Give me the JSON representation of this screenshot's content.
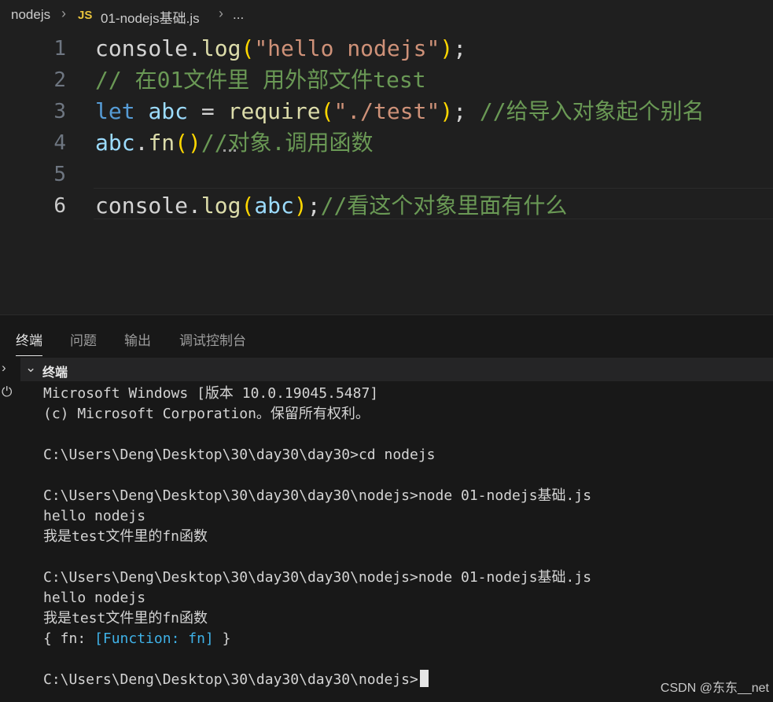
{
  "breadcrumb": {
    "folder": "nodejs",
    "file_badge": "JS",
    "file": "01-nodejs基础.js",
    "ellipsis": "..."
  },
  "editor": {
    "line_numbers": [
      "1",
      "2",
      "3",
      "4",
      "5",
      "6"
    ],
    "lines": [
      [
        {
          "t": "console",
          "c": "t-plain"
        },
        {
          "t": ".",
          "c": "t-plain"
        },
        {
          "t": "log",
          "c": "t-fn"
        },
        {
          "t": "(",
          "c": "t-paren"
        },
        {
          "t": "\"hello nodejs\"",
          "c": "t-str"
        },
        {
          "t": ")",
          "c": "t-paren"
        },
        {
          "t": ";",
          "c": "t-plain"
        }
      ],
      [
        {
          "t": "// 在01文件里 用外部文件test",
          "c": "t-com"
        }
      ],
      [
        {
          "t": "let",
          "c": "t-kw"
        },
        {
          "t": " ",
          "c": "t-plain"
        },
        {
          "t": "abc",
          "c": "t-var"
        },
        {
          "t": " = ",
          "c": "t-plain"
        },
        {
          "t": "require",
          "c": "t-fn"
        },
        {
          "t": "(",
          "c": "t-paren"
        },
        {
          "t": "\"./test\"",
          "c": "t-str"
        },
        {
          "t": ")",
          "c": "t-paren"
        },
        {
          "t": "; ",
          "c": "t-plain"
        },
        {
          "t": "//给导入对象起个别名",
          "c": "t-com"
        }
      ],
      [
        {
          "t": "abc",
          "c": "t-var"
        },
        {
          "t": ".",
          "c": "t-plain"
        },
        {
          "t": "fn",
          "c": "t-fn"
        },
        {
          "t": "()",
          "c": "t-paren"
        },
        {
          "t": "//对象.调用函数",
          "c": "t-com"
        }
      ],
      [],
      [
        {
          "t": "console",
          "c": "t-plain"
        },
        {
          "t": ".",
          "c": "t-plain"
        },
        {
          "t": "log",
          "c": "t-fn"
        },
        {
          "t": "(",
          "c": "t-paren"
        },
        {
          "t": "abc",
          "c": "t-var"
        },
        {
          "t": ")",
          "c": "t-paren"
        },
        {
          "t": ";",
          "c": "t-plain"
        },
        {
          "t": "//看这个对象里面有什么",
          "c": "t-com"
        }
      ]
    ]
  },
  "panel": {
    "tabs": [
      "终端",
      "问题",
      "输出",
      "调试控制台"
    ],
    "active_tab": "终端",
    "terminal_header": "终端"
  },
  "terminal": {
    "lines": [
      [
        {
          "t": "Microsoft Windows [版本 10.0.19045.5487]"
        }
      ],
      [
        {
          "t": "(c) Microsoft Corporation。保留所有权利。"
        }
      ],
      [],
      [
        {
          "t": "C:\\Users\\Deng\\Desktop\\30\\day30\\day30>cd nodejs"
        }
      ],
      [],
      [
        {
          "t": "C:\\Users\\Deng\\Desktop\\30\\day30\\day30\\nodejs>node 01-nodejs基础.js"
        }
      ],
      [
        {
          "t": "hello nodejs"
        }
      ],
      [
        {
          "t": "我是test文件里的fn函数"
        }
      ],
      [],
      [
        {
          "t": "C:\\Users\\Deng\\Desktop\\30\\day30\\day30\\nodejs>node 01-nodejs基础.js"
        }
      ],
      [
        {
          "t": "hello nodejs"
        }
      ],
      [
        {
          "t": "我是test文件里的fn函数"
        }
      ],
      [
        {
          "t": "{ fn: "
        },
        {
          "t": "[Function: fn]",
          "c": "t-fninfo"
        },
        {
          "t": " }"
        }
      ],
      [],
      [
        {
          "t": "C:\\Users\\Deng\\Desktop\\30\\day30\\day30\\nodejs>"
        }
      ]
    ]
  },
  "watermark": "CSDN @东东__net"
}
